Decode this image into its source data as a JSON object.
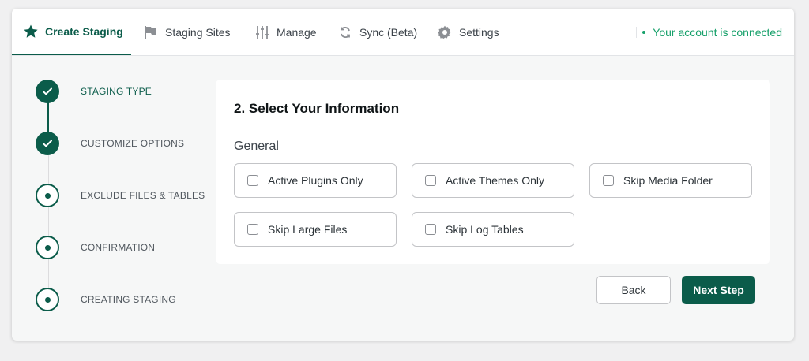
{
  "nav": {
    "tabs": [
      {
        "label": "Create Staging",
        "icon": "star-icon",
        "active": true
      },
      {
        "label": "Staging Sites",
        "icon": "flag-icon"
      },
      {
        "label": "Manage",
        "icon": "sliders-icon"
      },
      {
        "label": "Sync (Beta)",
        "icon": "sync-icon"
      },
      {
        "label": "Settings",
        "icon": "gear-icon"
      }
    ],
    "status": "Your account is connected"
  },
  "steps": [
    {
      "label": "STAGING TYPE",
      "state": "done"
    },
    {
      "label": "CUSTOMIZE OPTIONS",
      "state": "done"
    },
    {
      "label": "EXCLUDE FILES & TABLES",
      "state": "todo"
    },
    {
      "label": "CONFIRMATION",
      "state": "todo"
    },
    {
      "label": "CREATING STAGING",
      "state": "todo"
    }
  ],
  "form": {
    "title": "2. Select Your Information",
    "group": "General",
    "options": [
      {
        "label": "Active Plugins Only",
        "checked": false
      },
      {
        "label": "Active Themes Only",
        "checked": false
      },
      {
        "label": "Skip Media Folder",
        "checked": false
      },
      {
        "label": "Skip Large Files",
        "checked": false
      },
      {
        "label": "Skip Log Tables",
        "checked": false
      }
    ]
  },
  "buttons": {
    "back": "Back",
    "next": "Next Step"
  },
  "colors": {
    "accent": "#0b5c4a",
    "connected": "#16a06a"
  }
}
